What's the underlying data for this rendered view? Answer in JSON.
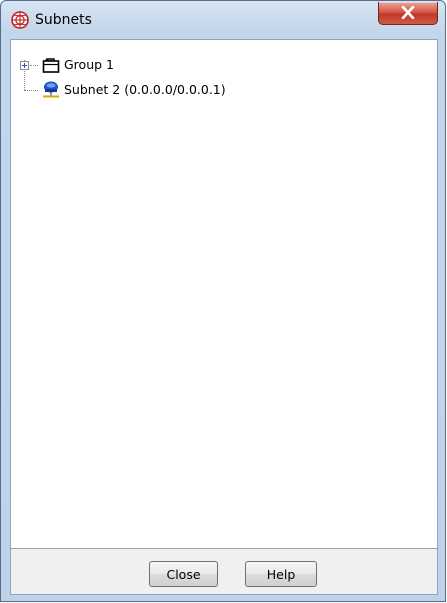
{
  "window": {
    "title": "Subnets",
    "app_icon": "globe-icon",
    "close_icon": "close-icon"
  },
  "tree": {
    "items": [
      {
        "label": "Group 1",
        "icon": "group-folder-icon",
        "expandable": true
      },
      {
        "label": "Subnet 2 (0.0.0.0/0.0.0.1)",
        "icon": "subnet-icon",
        "expandable": false
      }
    ]
  },
  "buttons": {
    "close_label": "Close",
    "help_label": "Help"
  },
  "colors": {
    "title_bar": "#c4d6ea",
    "close_button": "#c8483a",
    "client_background": "#f0f0f0"
  }
}
